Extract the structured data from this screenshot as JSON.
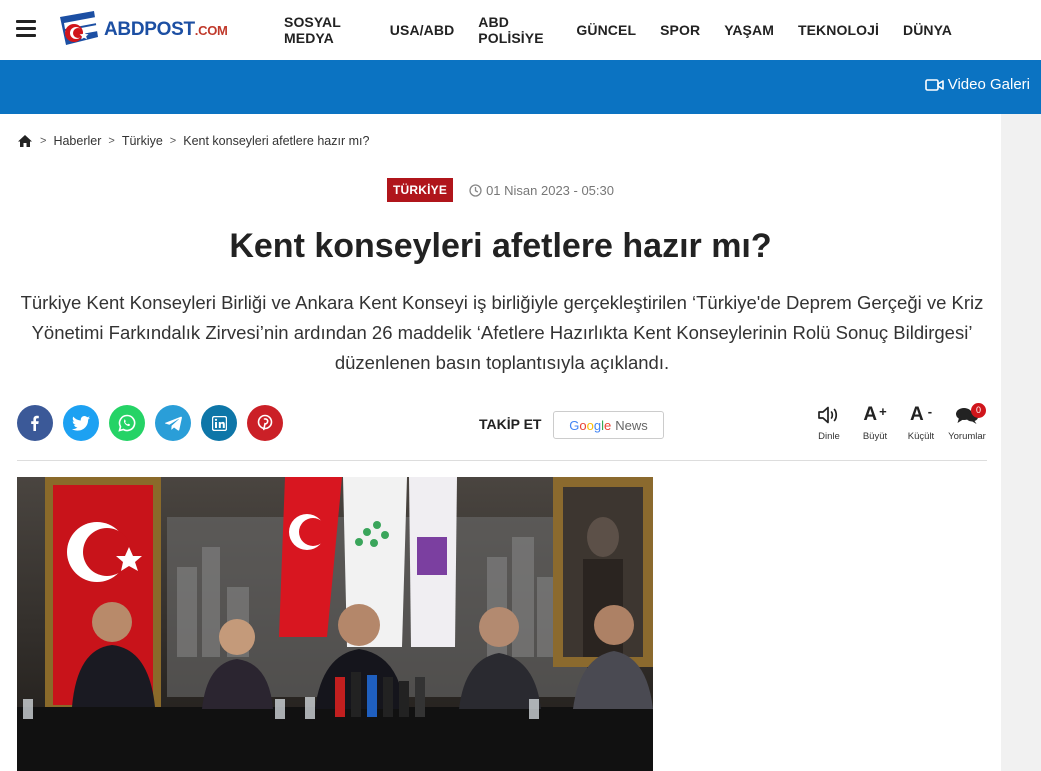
{
  "header": {
    "logo_main": "ABDPOST",
    "logo_suffix": ".COM",
    "menu": [
      "SOSYAL MEDYA",
      "USA/ABD",
      "ABD POLİSİYE",
      "GÜNCEL",
      "SPOR",
      "YAŞAM",
      "TEKNOLOJİ",
      "DÜNYA"
    ]
  },
  "bluebar": {
    "video_label": "Video Galeri"
  },
  "breadcrumb": {
    "items": [
      "Haberler",
      "Türkiye",
      "Kent konseyleri afetlere hazır mı?"
    ]
  },
  "article": {
    "category": "TÜRKİYE",
    "date": "01 Nisan 2023 - 05:30",
    "title": "Kent konseyleri afetlere hazır mı?",
    "summary": "Türkiye Kent Konseyleri Birliği ve Ankara Kent Konseyi iş birliğiyle gerçekleştirilen ‘Türkiye'de Deprem Gerçeği ve Kriz Yönetimi Farkındalık Zirvesi’nin ardından 26 maddelik ‘Afetlere Hazırlıkta Kent Konseylerinin Rolü Sonuç Bildirgesi’ düzenlenen basın toplantısıyla açıklandı."
  },
  "follow": {
    "label": "TAKİP ET",
    "google": "Google",
    "news": "News"
  },
  "tools": {
    "listen": "Dinle",
    "bigger": "Büyüt",
    "smaller": "Küçült",
    "comments": "Yorumlar",
    "comment_count": "0"
  },
  "colors": {
    "brand_blue": "#0b73c2",
    "category_red": "#b0151b",
    "facebook": "#3b5998",
    "twitter": "#1da1f2",
    "whatsapp": "#25d366",
    "telegram": "#2a9ed8",
    "linkedin": "#0e76a8",
    "pinterest": "#cb2027"
  }
}
